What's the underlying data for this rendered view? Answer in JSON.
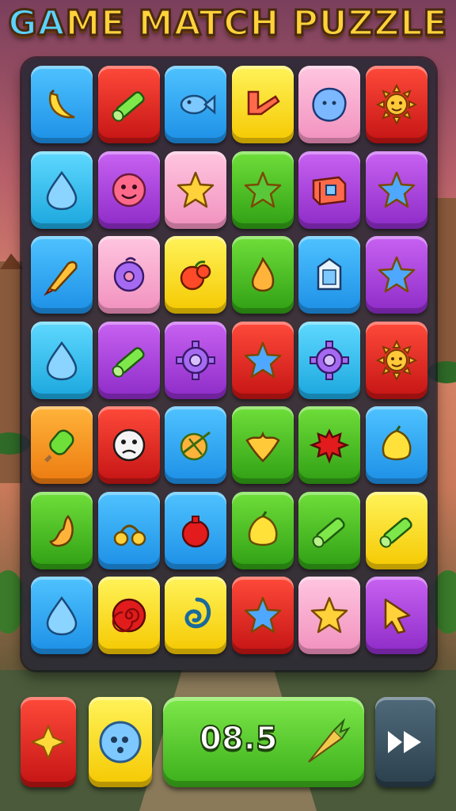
{
  "title": {
    "part1": "GA",
    "part2": "ME MATCH PUZZLE"
  },
  "board": {
    "rows": [
      [
        {
          "color": "c-blue",
          "icon": "banana-icon"
        },
        {
          "color": "c-red",
          "icon": "crayon-icon"
        },
        {
          "color": "c-blue",
          "icon": "fish-icon"
        },
        {
          "color": "c-yellow",
          "icon": "arrow-shape-icon"
        },
        {
          "color": "c-pink",
          "icon": "blob-icon"
        },
        {
          "color": "c-red",
          "icon": "sun-icon"
        }
      ],
      [
        {
          "color": "c-cyan",
          "icon": "drop-icon"
        },
        {
          "color": "c-purple",
          "icon": "smiley-icon"
        },
        {
          "color": "c-pink",
          "icon": "star-icon"
        },
        {
          "color": "c-green",
          "icon": "star-icon"
        },
        {
          "color": "c-purple",
          "icon": "candy-box-icon"
        },
        {
          "color": "c-purple",
          "icon": "star-icon"
        }
      ],
      [
        {
          "color": "c-blue",
          "icon": "rocket-icon"
        },
        {
          "color": "c-pink",
          "icon": "donut-icon"
        },
        {
          "color": "c-yellow",
          "icon": "apple-icon"
        },
        {
          "color": "c-green",
          "icon": "flame-icon"
        },
        {
          "color": "c-blue",
          "icon": "tablet-icon"
        },
        {
          "color": "c-purple",
          "icon": "star-icon"
        }
      ],
      [
        {
          "color": "c-cyan",
          "icon": "drop-icon"
        },
        {
          "color": "c-purple",
          "icon": "crayon-icon"
        },
        {
          "color": "c-purple",
          "icon": "gear-icon"
        },
        {
          "color": "c-red",
          "icon": "star-icon"
        },
        {
          "color": "c-cyan",
          "icon": "gear-icon"
        },
        {
          "color": "c-red",
          "icon": "sun-icon"
        }
      ],
      [
        {
          "color": "c-orange",
          "icon": "popsicle-icon"
        },
        {
          "color": "c-red",
          "icon": "face-icon"
        },
        {
          "color": "c-blue",
          "icon": "ball-icon"
        },
        {
          "color": "c-green",
          "icon": "leaf-icon"
        },
        {
          "color": "c-green",
          "icon": "splat-icon"
        },
        {
          "color": "c-blue",
          "icon": "lemon-icon"
        }
      ],
      [
        {
          "color": "c-green",
          "icon": "bird-icon"
        },
        {
          "color": "c-blue",
          "icon": "cherries-icon"
        },
        {
          "color": "c-blue",
          "icon": "bomb-icon"
        },
        {
          "color": "c-green",
          "icon": "lemon-icon"
        },
        {
          "color": "c-green",
          "icon": "crayon-icon"
        },
        {
          "color": "c-yellow",
          "icon": "crayon-icon"
        }
      ],
      [
        {
          "color": "c-blue",
          "icon": "drop-icon"
        },
        {
          "color": "c-yellow",
          "icon": "swirl-icon"
        },
        {
          "color": "c-yellow",
          "icon": "spiral-icon"
        },
        {
          "color": "c-red",
          "icon": "star-icon"
        },
        {
          "color": "c-pink",
          "icon": "star-icon"
        },
        {
          "color": "c-purple",
          "icon": "cursor-icon"
        }
      ]
    ]
  },
  "bottom": {
    "score": "08.5",
    "left_icon": "sparkle-icon",
    "face_icon": "face-button-icon",
    "score_icon": "carrot-icon",
    "skip_icon": "fast-forward-icon"
  }
}
